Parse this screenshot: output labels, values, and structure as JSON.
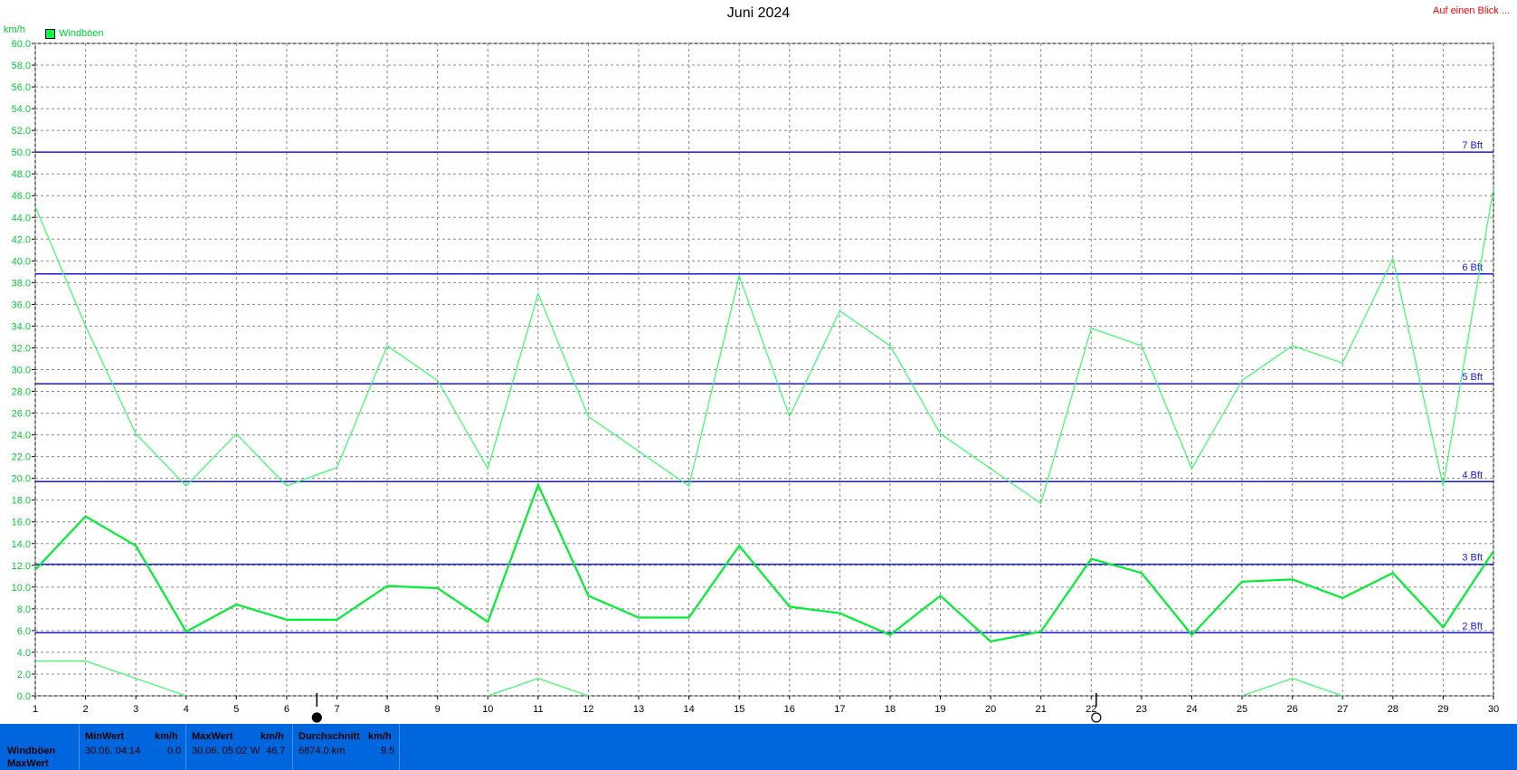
{
  "header": {
    "title": "Juni 2024",
    "link_label": "Auf einen Blick ...",
    "unit_label": "km/h",
    "legend_label": "Windböen"
  },
  "colors": {
    "gust": "#33ff66",
    "avg": "#00ee33",
    "bft": "#1a1adb",
    "grid": "#888888",
    "footer": "#0066dd"
  },
  "chart_data": {
    "type": "line",
    "title": "Juni 2024",
    "ylabel": "km/h",
    "xlabel": "",
    "ylim": [
      0,
      60
    ],
    "xlim": [
      1,
      30
    ],
    "grid": true,
    "legend_placement": "top-left",
    "x": [
      1,
      2,
      3,
      4,
      5,
      6,
      7,
      8,
      9,
      10,
      11,
      12,
      13,
      14,
      15,
      16,
      17,
      18,
      19,
      20,
      21,
      22,
      23,
      24,
      25,
      26,
      27,
      28,
      29,
      30
    ],
    "x_tick_labels": [
      "1",
      "2",
      "3",
      "4",
      "5",
      "6",
      "7",
      "8",
      "9",
      "10",
      "11",
      "12",
      "13",
      "14",
      "15",
      "16",
      "17",
      "18",
      "19",
      "20",
      "21",
      "22",
      "23",
      "24",
      "25",
      "26",
      "27",
      "28",
      "29",
      "30"
    ],
    "y_tick_labels": [
      "0.0",
      "2.0",
      "4.0",
      "6.0",
      "8.0",
      "10.0",
      "12.0",
      "14.0",
      "16.0",
      "18.0",
      "20.0",
      "22.0",
      "24.0",
      "26.0",
      "28.0",
      "30.0",
      "32.0",
      "34.0",
      "36.0",
      "38.0",
      "40.0",
      "42.0",
      "44.0",
      "46.0",
      "48.0",
      "50.0",
      "52.0",
      "54.0",
      "56.0",
      "58.0",
      "60.0"
    ],
    "series": [
      {
        "name": "Windböen",
        "role": "max",
        "values": [
          45.0,
          34.0,
          24.1,
          19.3,
          24.1,
          19.3,
          21.0,
          32.2,
          29.0,
          20.9,
          37.0,
          25.7,
          22.5,
          19.3,
          38.6,
          25.7,
          35.4,
          32.2,
          24.1,
          20.9,
          17.7,
          33.8,
          32.2,
          20.9,
          29.0,
          32.2,
          30.6,
          40.2,
          19.3,
          46.7
        ]
      },
      {
        "role": "avg",
        "values": [
          11.6,
          16.5,
          13.8,
          5.9,
          8.4,
          7.0,
          7.0,
          10.1,
          9.9,
          6.8,
          19.4,
          9.2,
          7.2,
          7.2,
          13.8,
          8.2,
          7.6,
          5.6,
          9.2,
          5.0,
          5.9,
          12.6,
          11.3,
          5.6,
          10.5,
          10.7,
          9.0,
          11.3,
          6.3,
          13.3
        ]
      },
      {
        "role": "min",
        "values": [
          3.2,
          3.2,
          1.6,
          0.0,
          null,
          null,
          null,
          null,
          null,
          0.0,
          1.6,
          0.0,
          null,
          null,
          null,
          null,
          null,
          null,
          null,
          null,
          null,
          null,
          null,
          null,
          0.0,
          1.6,
          0.0,
          null,
          null,
          null
        ]
      }
    ],
    "reference_lines": [
      {
        "label": "2 Bft",
        "value": 5.8
      },
      {
        "label": "3 Bft",
        "value": 12.1
      },
      {
        "label": "4 Bft",
        "value": 19.7
      },
      {
        "label": "5 Bft",
        "value": 28.7
      },
      {
        "label": "6 Bft",
        "value": 38.8
      },
      {
        "label": "7 Bft",
        "value": 50.0
      }
    ],
    "moon_markers": [
      {
        "type": "new-moon",
        "x": 6.6
      },
      {
        "type": "full-moon",
        "x": 22.1
      }
    ]
  },
  "footer": {
    "row_label_1": "Windböen",
    "row_label_2": "MaxWert",
    "min_header": "MinWert",
    "min_unit": "km/h",
    "min_time": "30.06.  04:14",
    "min_value": "0.0",
    "max_header": "MaxWert",
    "max_unit": "km/h",
    "max_time": "30.06.  05:02",
    "max_dir": "W",
    "max_value": "46.7",
    "avg_header": "Durchschnitt",
    "avg_unit": "km/h",
    "avg_distance": "6874.0 km",
    "avg_value": "9.5"
  }
}
